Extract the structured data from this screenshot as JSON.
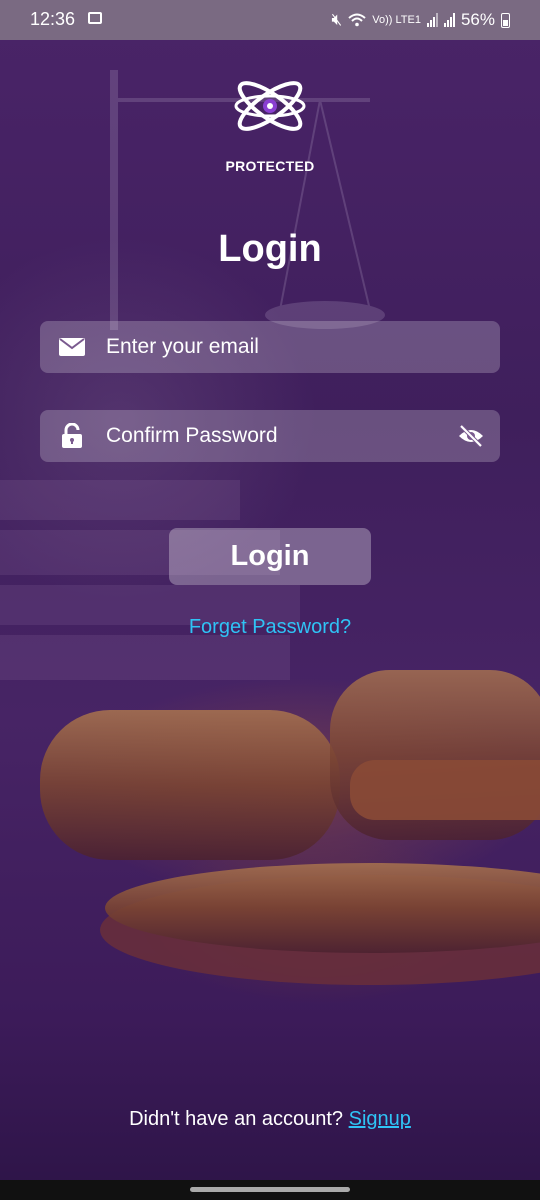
{
  "status_bar": {
    "time": "12:36",
    "network_label": "Vo)) LTE1",
    "battery": "56%",
    "icons": [
      "image-icon",
      "mute-icon",
      "wifi-icon",
      "signal-icon",
      "battery-icon"
    ]
  },
  "logo": {
    "text": "PROTECTED",
    "icon": "atom-logo-icon"
  },
  "title": "Login",
  "email_field": {
    "placeholder": "Enter your email",
    "value": "",
    "icon": "mail-icon"
  },
  "password_field": {
    "placeholder": "Confirm Password",
    "value": "",
    "icon": "lock-icon",
    "toggle_icon": "eye-off-icon"
  },
  "login_button": {
    "label": "Login"
  },
  "forgot_link": {
    "label": "Forget Password?"
  },
  "signup": {
    "prompt": "Didn't have an account?",
    "link": "Signup"
  },
  "colors": {
    "accent_link": "#2fc3f5",
    "background": "#4a2468",
    "field_bg": "rgba(255,255,255,0.22)"
  }
}
